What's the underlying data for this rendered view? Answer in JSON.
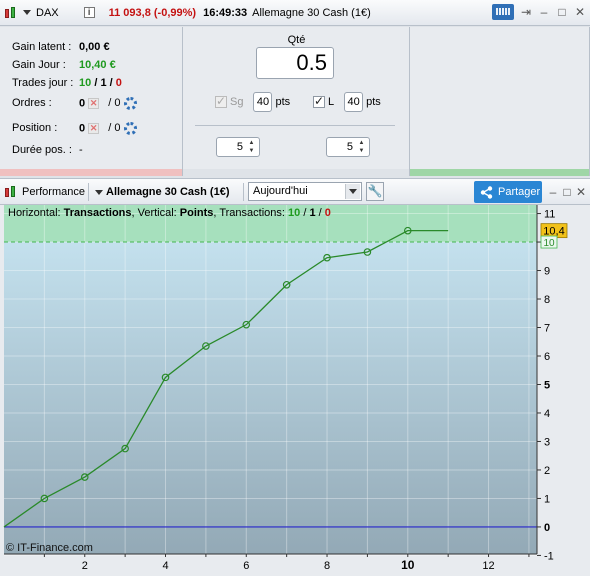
{
  "top_window": {
    "instrument": "DAX",
    "price": "11 093,8 (-0,99%)",
    "time": "16:49:33",
    "contract": "Allemagne 30 Cash (1€)",
    "info_label": "i"
  },
  "stats": {
    "gain_latent_label": "Gain latent :",
    "gain_latent_value": "0,00 €",
    "gain_jour_label": "Gain Jour :",
    "gain_jour_value": "10,40 €",
    "trades_label": "Trades jour :",
    "trades_total": "10",
    "trades_win": "1",
    "trades_loss": "0",
    "trades_sep": "/",
    "ordres_label": "Ordres :",
    "ordres_a": "0",
    "ordres_b": "/ 0",
    "position_label": "Position :",
    "position_a": "0",
    "position_b": "/ 0",
    "duree_label": "Durée pos. :",
    "duree_value": "-"
  },
  "order_panel": {
    "qte_label": "Qté",
    "qte_value": "0.5",
    "sg_label": "Sg",
    "sg_value": "40",
    "sg_unit": "pts",
    "l_label": "L",
    "l_value": "40",
    "l_unit": "pts",
    "spinner_left": "5",
    "spinner_right": "5"
  },
  "perf_window": {
    "title": "Performance",
    "contract": "Allemagne 30 Cash (1€)",
    "period": "Aujourd'hui",
    "share_label": "Partager",
    "legend_prefix": "Horizontal: ",
    "legend_h": "Transactions",
    "legend_mid": ", Vertical: ",
    "legend_v": "Points",
    "legend_tx": ", Transactions: ",
    "legend_total": "10",
    "legend_win": "1",
    "legend_loss": "0",
    "legend_sep": " / ",
    "copyright": "© IT-Finance.com"
  },
  "colors": {
    "line": "#2a8a2a",
    "zero_line": "#2323c8",
    "plot_top": "#c9e7f4",
    "plot_bottom": "#93a9b6",
    "gain_band": "#a6e0bd",
    "gain_dash": "#46b850",
    "label_box": "#f2c21a"
  },
  "chart_data": {
    "type": "line",
    "x": [
      0,
      1,
      2,
      3,
      4,
      5,
      6,
      7,
      8,
      9,
      10,
      11
    ],
    "y": [
      0,
      1.0,
      1.75,
      2.75,
      5.25,
      6.35,
      7.1,
      8.5,
      9.45,
      9.65,
      10.4,
      10.4
    ],
    "markers": [
      1,
      2,
      3,
      4,
      5,
      6,
      7,
      8,
      9,
      10
    ],
    "xlim": [
      0,
      13.2
    ],
    "ylim": [
      -0.95,
      11.3
    ],
    "xticks": [
      2,
      4,
      6,
      8,
      10,
      12
    ],
    "xtick_bold": [
      10
    ],
    "yticks": [
      -1,
      0,
      1,
      2,
      3,
      4,
      5,
      6,
      7,
      8,
      9,
      10,
      11
    ],
    "ytick_bold": [
      0,
      5
    ],
    "value_label": "10,4",
    "value_label2": "10",
    "gain_level": 10,
    "grid": true
  }
}
